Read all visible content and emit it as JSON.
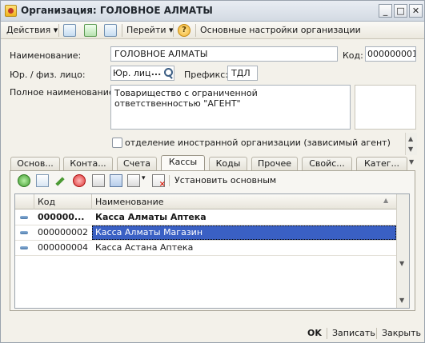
{
  "window": {
    "title": "Организация: ГОЛОВНОЕ АЛМАТЫ",
    "minimize_glyph": "_",
    "maximize_glyph": "□",
    "close_glyph": "✕"
  },
  "toolbar": {
    "actions_label": "Действия",
    "goto_label": "Перейти",
    "help_glyph": "?",
    "settings_label": "Основные настройки организации",
    "dropdown_glyph": "▾"
  },
  "form": {
    "name_label": "Наименование:",
    "name_value": "ГОЛОВНОЕ АЛМАТЫ",
    "code_label": "Код:",
    "code_value": "000000001",
    "entity_type_label": "Юр. / физ. лицо:",
    "entity_type_value": "Юр. лицо",
    "entity_type_button": "...",
    "prefix_label": "Префикс:",
    "prefix_value": "ТДЛ",
    "full_name_label": "Полное наименование:",
    "full_name_value": "Товарищество с ограниченной ответственностью \"АГЕНТ\"",
    "foreign_branch_label": "отделение иностранной организации (зависимый агент)",
    "foreign_branch_checked": false
  },
  "tabs": [
    {
      "label": "Основ..."
    },
    {
      "label": "Конта..."
    },
    {
      "label": "Счета"
    },
    {
      "label": "Кассы",
      "active": true
    },
    {
      "label": "Коды"
    },
    {
      "label": "Прочее"
    },
    {
      "label": "Свойс..."
    },
    {
      "label": "Катег..."
    }
  ],
  "subtoolbar": {
    "set_main_label": "Установить основным"
  },
  "table": {
    "columns": [
      "Код",
      "Наименование"
    ],
    "rows": [
      {
        "code": "000000...",
        "name": "Касса Алматы Аптека",
        "bold": true,
        "selected": false
      },
      {
        "code": "000000002",
        "name": "Касса Алматы Магазин",
        "bold": false,
        "selected": true
      },
      {
        "code": "000000004",
        "name": "Касса Астана Аптека",
        "bold": false,
        "selected": false
      }
    ]
  },
  "footer": {
    "ok_label": "OK",
    "save_label": "Записать",
    "close_label": "Закрыть"
  },
  "colors": {
    "selection": "#3a60c4",
    "window_bg": "#f3f1ea"
  }
}
